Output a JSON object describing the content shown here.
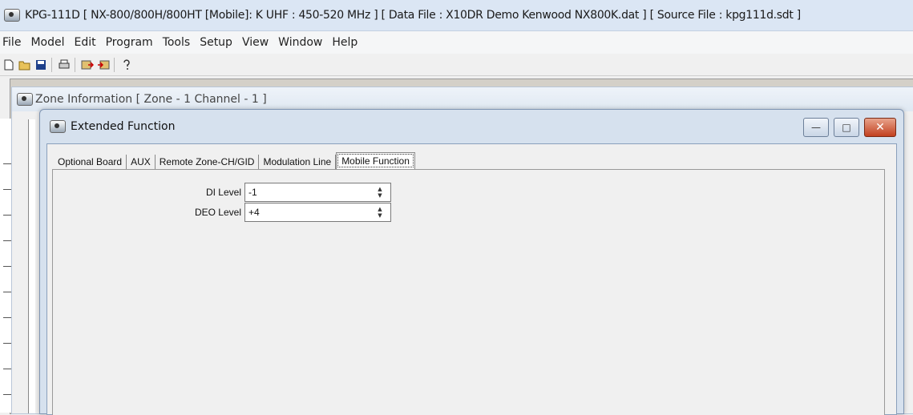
{
  "window": {
    "title": "KPG-111D  [ NX-800/800H/800HT  [Mobile]: K UHF : 450-520 MHz ] [ Data File : X10DR Demo Kenwood NX800K.dat ] [ Source File : kpg111d.sdt ]"
  },
  "menu": {
    "items": [
      {
        "label": "File"
      },
      {
        "label": "Model"
      },
      {
        "label": "Edit"
      },
      {
        "label": "Program"
      },
      {
        "label": "Tools"
      },
      {
        "label": "Setup"
      },
      {
        "label": "View"
      },
      {
        "label": "Window"
      },
      {
        "label": "Help"
      }
    ]
  },
  "toolbar": {
    "icons": [
      "new-file-icon",
      "open-folder-icon",
      "save-icon",
      "print-icon",
      "read-radio-icon",
      "write-radio-icon",
      "help-icon"
    ]
  },
  "zone_window": {
    "title": "Zone Information [ Zone - 1  Channel - 1 ]"
  },
  "extended_window": {
    "title": "Extended Function",
    "buttons": {
      "minimize": "—",
      "maximize": "□",
      "close": "✕"
    },
    "tabs": [
      {
        "label": "Optional Board",
        "active": false
      },
      {
        "label": "AUX",
        "active": false
      },
      {
        "label": "Remote Zone-CH/GID",
        "active": false
      },
      {
        "label": "Modulation Line",
        "active": false
      },
      {
        "label": "Mobile Function",
        "active": true
      }
    ],
    "fields": {
      "di_level": {
        "label": "DI Level",
        "value": "-1"
      },
      "deo_level": {
        "label": "DEO Level",
        "value": "+4"
      }
    }
  }
}
